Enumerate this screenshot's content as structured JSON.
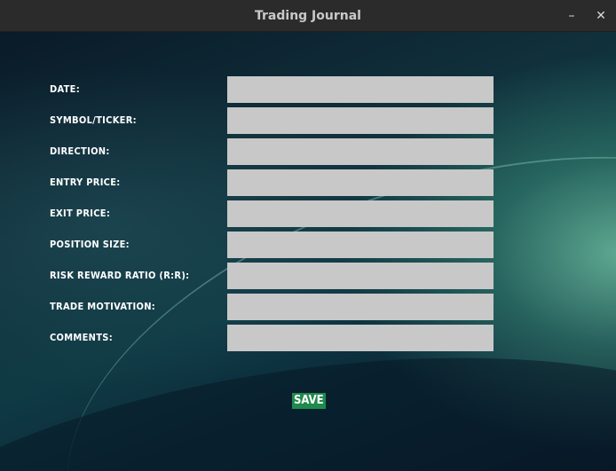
{
  "window": {
    "title": "Trading Journal",
    "minimize_glyph": "–",
    "close_glyph": "✕"
  },
  "form": {
    "fields": [
      {
        "label": "Date:",
        "value": ""
      },
      {
        "label": "Symbol/Ticker:",
        "value": ""
      },
      {
        "label": "Direction:",
        "value": ""
      },
      {
        "label": "Entry Price:",
        "value": ""
      },
      {
        "label": "Exit Price:",
        "value": ""
      },
      {
        "label": "Position Size:",
        "value": ""
      },
      {
        "label": "Risk Reward Ratio (R:R):",
        "value": ""
      },
      {
        "label": "Trade Motivation:",
        "value": ""
      },
      {
        "label": "Comments:",
        "value": ""
      }
    ],
    "save_label": "SAVE"
  },
  "colors": {
    "field_background": "#c8c8c8",
    "save_background": "#1f8a4c",
    "titlebar": "#2b2b2b"
  }
}
